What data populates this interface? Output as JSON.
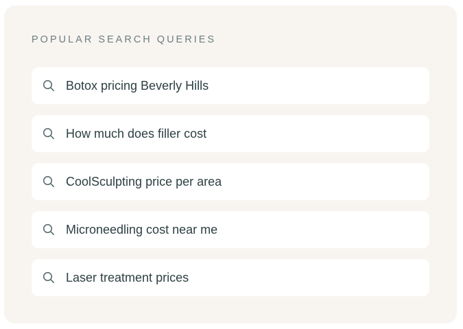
{
  "panel": {
    "heading": "POPULAR SEARCH QUERIES"
  },
  "queries": [
    {
      "label": "Botox pricing Beverly Hills",
      "icon": "search-icon"
    },
    {
      "label": "How much does filler cost",
      "icon": "search-icon"
    },
    {
      "label": "CoolSculpting price per area",
      "icon": "search-icon"
    },
    {
      "label": "Microneedling cost near me",
      "icon": "search-icon"
    },
    {
      "label": "Laser treatment prices",
      "icon": "search-icon"
    }
  ],
  "colors": {
    "panel_background": "#f8f5f1",
    "item_background": "#ffffff",
    "heading_text": "#6b7d80",
    "item_text": "#2d3f42",
    "icon": "#5b6e70"
  }
}
